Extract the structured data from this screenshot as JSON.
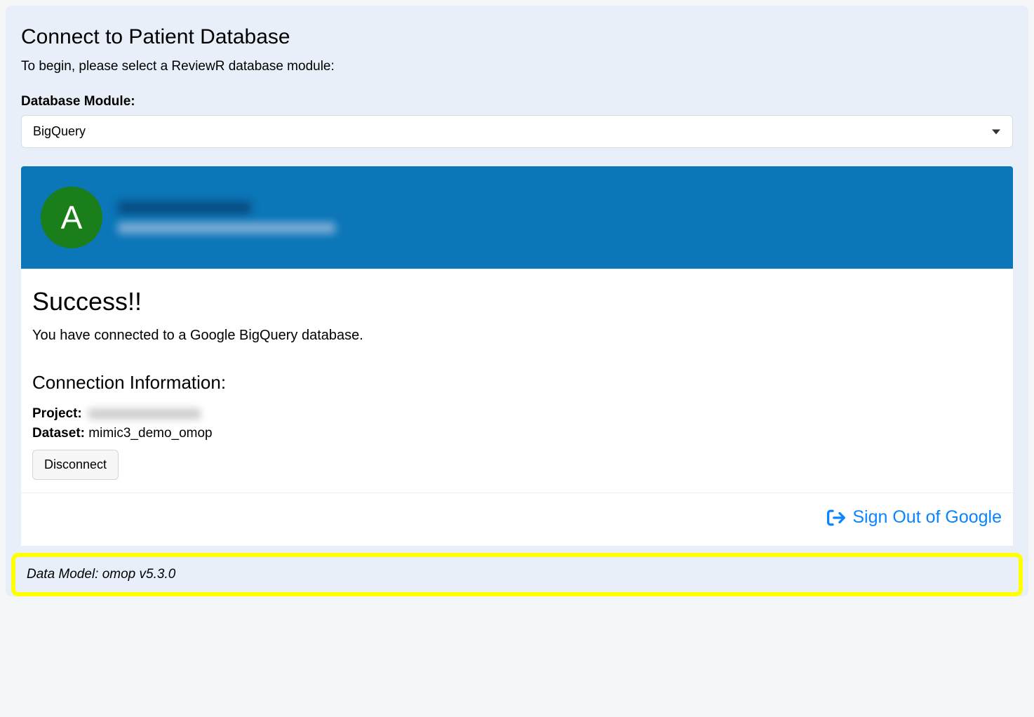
{
  "header": {
    "title": "Connect to Patient Database",
    "subtitle": "To begin, please select a ReviewR database module:"
  },
  "module_select": {
    "label": "Database Module:",
    "value": "BigQuery"
  },
  "user_card": {
    "avatar_letter": "A"
  },
  "success": {
    "title": "Success!!",
    "message": "You have connected to a Google BigQuery database."
  },
  "connection": {
    "heading": "Connection Information:",
    "project_label": "Project:",
    "dataset_label": "Dataset:",
    "dataset_value": "mimic3_demo_omop",
    "disconnect_label": "Disconnect"
  },
  "signout": {
    "label": "Sign Out of Google"
  },
  "data_model": {
    "text": "Data Model: omop v5.3.0"
  }
}
